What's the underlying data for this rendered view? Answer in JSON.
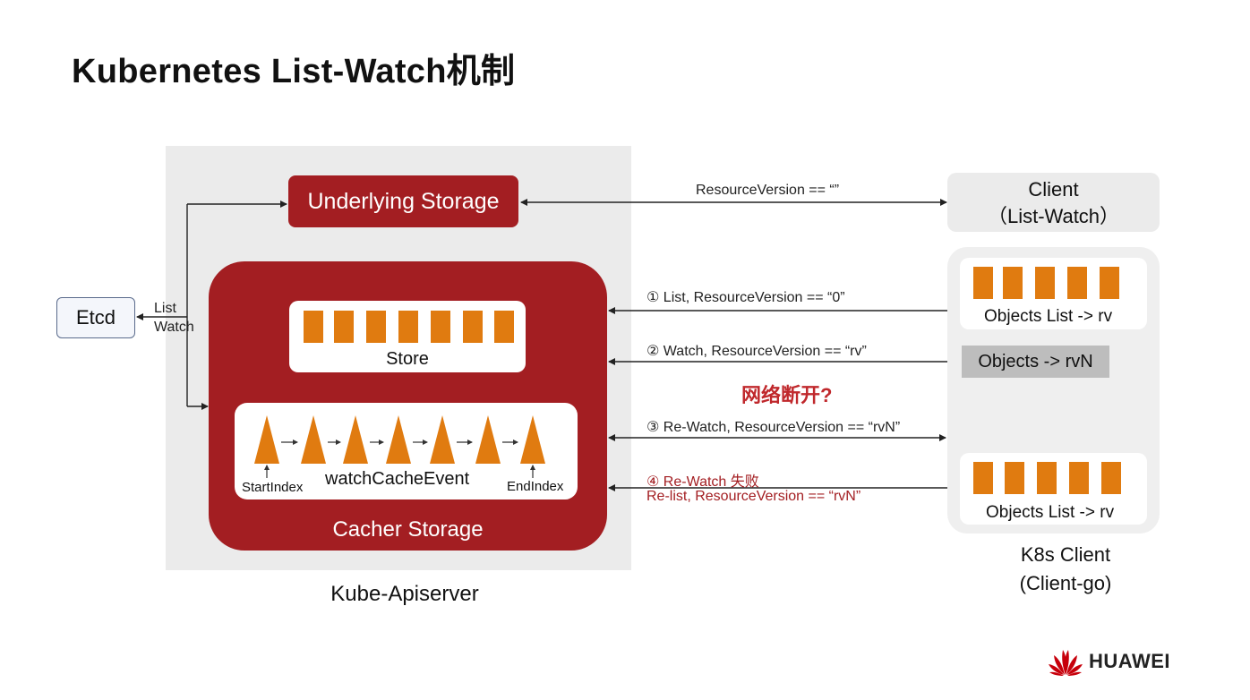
{
  "title": "Kubernetes List-Watch机制",
  "etcd": {
    "label": "Etcd",
    "list_label": "List",
    "watch_label": "Watch"
  },
  "apiserver": {
    "label": "Kube-Apiserver",
    "underlying_storage": "Underlying Storage",
    "cacher_storage": "Cacher Storage",
    "store": "Store",
    "watch_cache": {
      "label": "watchCacheEvent",
      "start": "StartIndex",
      "end": "EndIndex"
    }
  },
  "client_top": {
    "line1": "Client",
    "line2": "（List-Watch）"
  },
  "k8s_client": {
    "line1": "K8s Client",
    "line2": "(Client-go)"
  },
  "objects": {
    "list1": "Objects List -> rv",
    "rvN": "Objects -> rvN",
    "list2": "Objects List -> rv"
  },
  "arrows": {
    "rv_empty": "ResourceVersion ==  “”",
    "list": "① List, ResourceVersion ==  “0”",
    "watch": "② Watch, ResourceVersion ==  “rv”",
    "rewatch": "③ Re-Watch, ResourceVersion ==  “rvN”",
    "rewatch_fail_1": "④ Re-Watch 失败",
    "rewatch_fail_2": "Re-list, ResourceVersion ==  “rvN”"
  },
  "network_break": "网络断开?",
  "logo": {
    "text": "HUAWEI"
  },
  "colors": {
    "dark_red": "#a31e22",
    "orange": "#e07b10",
    "grey_panel": "#ebebeb"
  }
}
